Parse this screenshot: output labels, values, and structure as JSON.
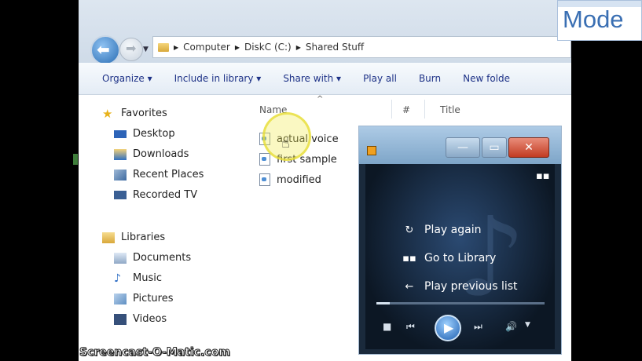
{
  "address": {
    "crumbs": [
      "Computer",
      "DiskC (C:)",
      "Shared Stuff"
    ]
  },
  "toolbar": {
    "items": [
      "Organize ▾",
      "Include in library ▾",
      "Share with ▾",
      "Play all",
      "Burn",
      "New folde"
    ]
  },
  "sidebar": {
    "favorites": [
      "Favorites",
      "Desktop",
      "Downloads",
      "Recent Places",
      "Recorded TV"
    ],
    "libraries": [
      "Libraries",
      "Documents",
      "Music",
      "Pictures",
      "Videos"
    ]
  },
  "columns": {
    "name": "Name",
    "number": "#",
    "title": "Title"
  },
  "files": [
    "actual voice",
    "first sample",
    "modified"
  ],
  "player": {
    "menu": [
      "Play again",
      "Go to Library",
      "Play previous list"
    ],
    "seek_fraction": 0.08
  },
  "overlay": {
    "watermark": "Screencast-O-Matic.com",
    "mode_label": "Mode"
  }
}
